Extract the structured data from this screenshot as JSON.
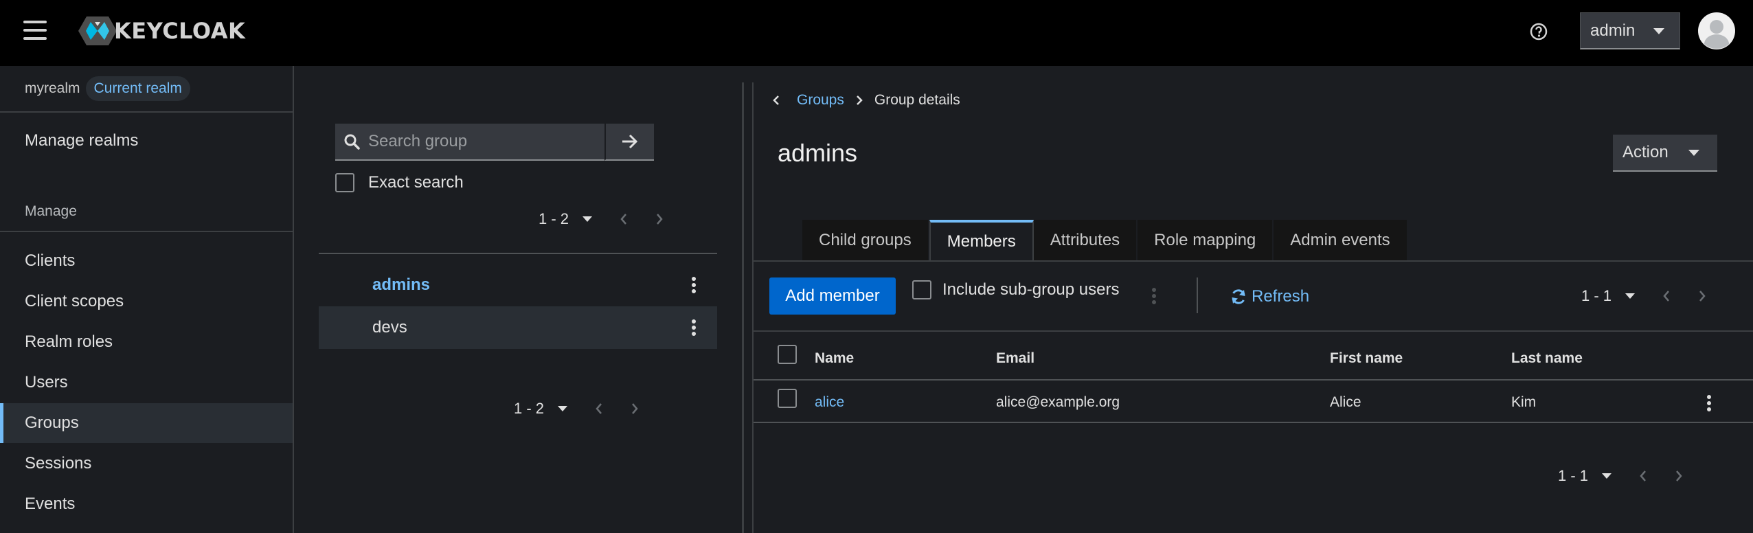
{
  "masthead": {
    "logo_text": "KEYCLOAK",
    "user_label": "admin"
  },
  "sidebar": {
    "realm_name": "myrealm",
    "realm_badge": "Current realm",
    "manage_realms": "Manage realms",
    "section_title": "Manage",
    "items": [
      {
        "label": "Clients"
      },
      {
        "label": "Client scopes"
      },
      {
        "label": "Realm roles"
      },
      {
        "label": "Users"
      },
      {
        "label": "Groups",
        "active": true
      },
      {
        "label": "Sessions"
      },
      {
        "label": "Events"
      }
    ]
  },
  "group_tree": {
    "search_placeholder": "Search group",
    "exact_search_label": "Exact search",
    "pager_top": "1 - 2",
    "pager_bottom": "1 - 2",
    "groups": [
      {
        "name": "admins",
        "selected": true
      },
      {
        "name": "devs",
        "selected": false
      }
    ]
  },
  "detail": {
    "breadcrumb": {
      "link": "Groups",
      "current": "Group details"
    },
    "title": "admins",
    "action_label": "Action",
    "tabs": [
      {
        "label": "Child groups"
      },
      {
        "label": "Members",
        "active": true
      },
      {
        "label": "Attributes"
      },
      {
        "label": "Role mapping"
      },
      {
        "label": "Admin events"
      }
    ],
    "toolbar": {
      "add_member": "Add member",
      "include_subgroup": "Include sub-group users",
      "refresh": "Refresh",
      "pager": "1 - 1"
    },
    "table": {
      "columns": [
        "Name",
        "Email",
        "First name",
        "Last name"
      ],
      "rows": [
        {
          "name": "alice",
          "email": "alice@example.org",
          "first_name": "Alice",
          "last_name": "Kim"
        }
      ]
    },
    "pager_bottom": "1 - 1"
  },
  "colors": {
    "accent": "#73bcf7",
    "primary_button": "#0066cc",
    "background": "#1b1d21",
    "masthead": "#000000"
  }
}
